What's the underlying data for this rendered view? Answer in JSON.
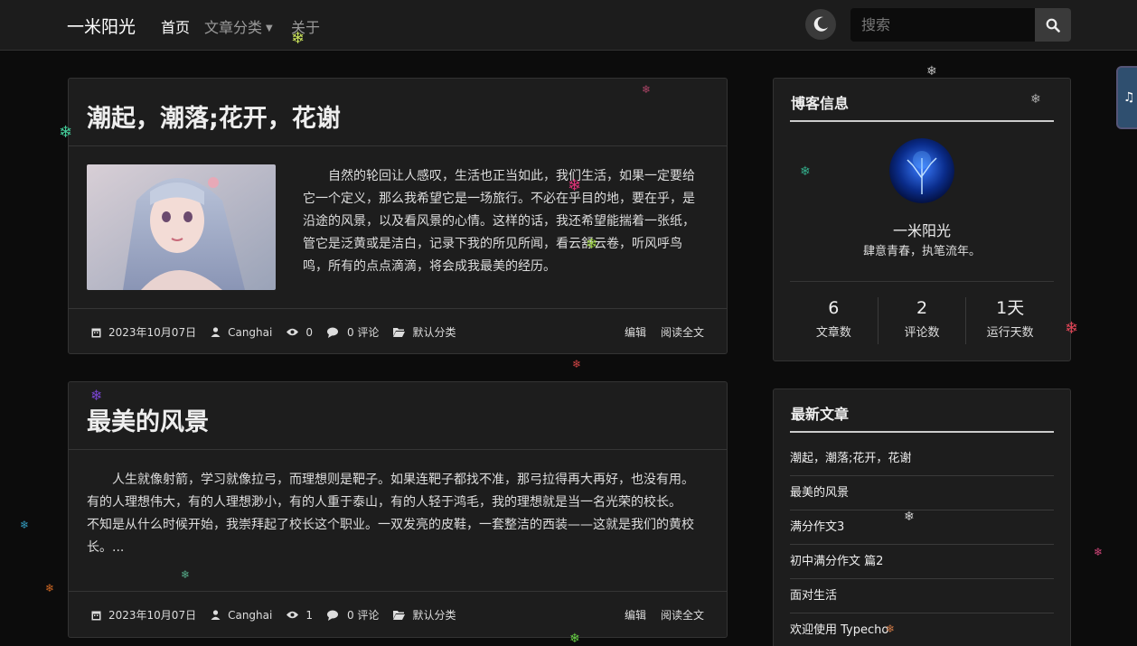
{
  "navbar": {
    "brand": "一米阳光",
    "home": "首页",
    "categories": "文章分类",
    "about": "关于",
    "search_placeholder": "搜索"
  },
  "posts": [
    {
      "title": "潮起，潮落;花开，花谢",
      "excerpt": "自然的轮回让人感叹，生活也正当如此，我们生活，如果一定要给它一个定义，那么我希望它是一场旅行。不必在乎目的地，要在乎，是沿途的风景，以及看风景的心情。这样的话，我还希望能揣着一张纸，管它是泛黄或是洁白，记录下我的所见所闻，看云舒云卷，听风呼鸟鸣，所有的点点滴滴，将会成我最美的经历。",
      "date": "2023年10月07日",
      "author": "Canghai",
      "views": "0",
      "comments": "0 评论",
      "category": "默认分类",
      "edit": "编辑",
      "read_more": "阅读全文"
    },
    {
      "title": "最美的风景",
      "excerpt": "人生就像射箭，学习就像拉弓，而理想则是靶子。如果连靶子都找不准，那弓拉得再大再好，也没有用。有的人理想伟大，有的人理想渺小，有的人重于泰山，有的人轻于鸿毛，我的理想就是当一名光荣的校长。　　不知是从什么时候开始，我崇拜起了校长这个职业。一双发亮的皮鞋，一套整洁的西装——这就是我们的黄校长。...",
      "date": "2023年10月07日",
      "author": "Canghai",
      "views": "1",
      "comments": "0 评论",
      "category": "默认分类",
      "edit": "编辑",
      "read_more": "阅读全文"
    }
  ],
  "sidebar": {
    "blog_info": {
      "title": "博客信息",
      "name": "一米阳光",
      "motto": "肆意青春，执笔流年。",
      "stats": [
        {
          "value": "6",
          "label": "文章数"
        },
        {
          "value": "2",
          "label": "评论数"
        },
        {
          "value": "1天",
          "label": "运行天数"
        }
      ]
    },
    "recent": {
      "title": "最新文章",
      "items": [
        "潮起，潮落;花开，花谢",
        "最美的风景",
        "满分作文3",
        "初中满分作文 篇2",
        "面对生活",
        "欢迎使用 Typecho"
      ]
    }
  },
  "colors": {
    "background": "#0c0c0c",
    "card": "#1d1d1d",
    "navbar": "#1c1c1c"
  }
}
